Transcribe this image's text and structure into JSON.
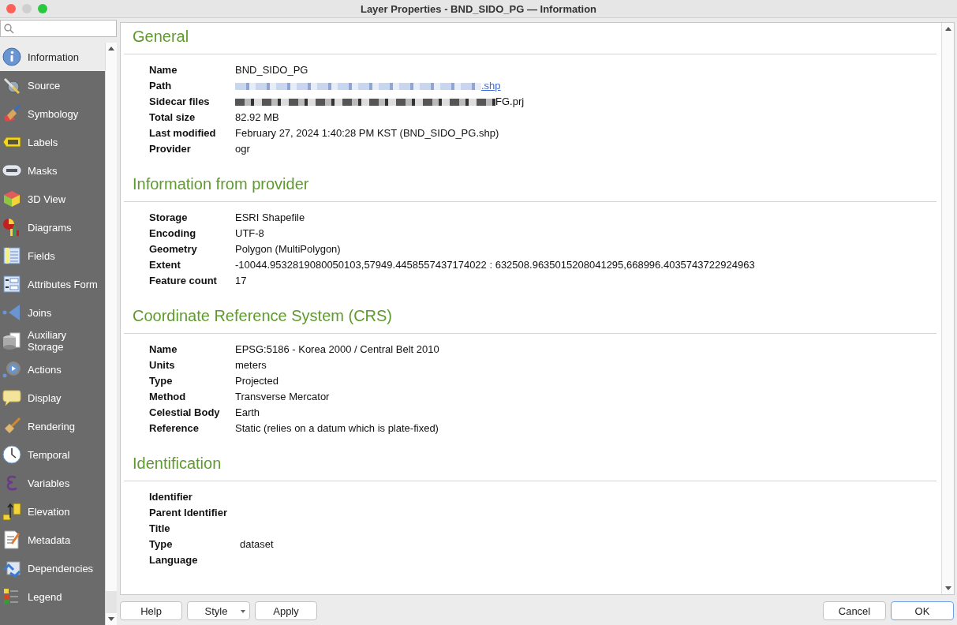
{
  "window": {
    "title": "Layer Properties - BND_SIDO_PG — Information"
  },
  "sidebar": {
    "items": [
      {
        "label": "Information",
        "selected": true
      },
      {
        "label": "Source",
        "selected": false
      },
      {
        "label": "Symbology",
        "selected": false
      },
      {
        "label": "Labels",
        "selected": false
      },
      {
        "label": "Masks",
        "selected": false
      },
      {
        "label": "3D View",
        "selected": false
      },
      {
        "label": "Diagrams",
        "selected": false
      },
      {
        "label": "Fields",
        "selected": false
      },
      {
        "label": "Attributes Form",
        "selected": false
      },
      {
        "label": "Joins",
        "selected": false
      },
      {
        "label": "Auxiliary Storage",
        "selected": false
      },
      {
        "label": "Actions",
        "selected": false
      },
      {
        "label": "Display",
        "selected": false
      },
      {
        "label": "Rendering",
        "selected": false
      },
      {
        "label": "Temporal",
        "selected": false
      },
      {
        "label": "Variables",
        "selected": false
      },
      {
        "label": "Elevation",
        "selected": false
      },
      {
        "label": "Metadata",
        "selected": false
      },
      {
        "label": "Dependencies",
        "selected": false
      },
      {
        "label": "Legend",
        "selected": false
      }
    ]
  },
  "sections": [
    {
      "title": "General",
      "rows": [
        {
          "label": "Name",
          "value": "BND_SIDO_PG"
        },
        {
          "label": "Path",
          "value": ".shp",
          "kind": "redacted-link"
        },
        {
          "label": "Sidecar files",
          "value": "FG.prj",
          "kind": "redacted"
        },
        {
          "label": "Total size",
          "value": "82.92 MB"
        },
        {
          "label": "Last modified",
          "value": "February 27, 2024 1:40:28 PM KST (BND_SIDO_PG.shp)"
        },
        {
          "label": "Provider",
          "value": "ogr"
        }
      ]
    },
    {
      "title": "Information from provider",
      "rows": [
        {
          "label": "Storage",
          "value": "ESRI Shapefile"
        },
        {
          "label": "Encoding",
          "value": "UTF-8"
        },
        {
          "label": "Geometry",
          "value": "Polygon (MultiPolygon)"
        },
        {
          "label": "Extent",
          "value": "-10044.9532819080050103,57949.4458557437174022 : 632508.9635015208041295,668996.4035743722924963"
        },
        {
          "label": "Feature count",
          "value": "17"
        }
      ]
    },
    {
      "title": "Coordinate Reference System (CRS)",
      "rows": [
        {
          "label": "Name",
          "value": "EPSG:5186 - Korea 2000 / Central Belt 2010"
        },
        {
          "label": "Units",
          "value": "meters"
        },
        {
          "label": "Type",
          "value": "Projected"
        },
        {
          "label": "Method",
          "value": "Transverse Mercator"
        },
        {
          "label": "Celestial Body",
          "value": "Earth"
        },
        {
          "label": "Reference",
          "value": "Static (relies on a datum which is plate-fixed)"
        }
      ]
    },
    {
      "title": "Identification",
      "rows": [
        {
          "label": "Identifier"
        },
        {
          "label": "Parent Identifier"
        },
        {
          "label": "Title"
        },
        {
          "label": "Type",
          "value": "dataset"
        },
        {
          "label": "Language"
        }
      ]
    }
  ],
  "buttons_left": [
    {
      "label": "Help",
      "kind": "plain"
    },
    {
      "label": "Style",
      "kind": "menu"
    },
    {
      "label": "Apply",
      "kind": "plain"
    }
  ],
  "buttons_right": [
    {
      "label": "Cancel",
      "kind": "plain"
    },
    {
      "label": "OK",
      "kind": "default"
    }
  ]
}
